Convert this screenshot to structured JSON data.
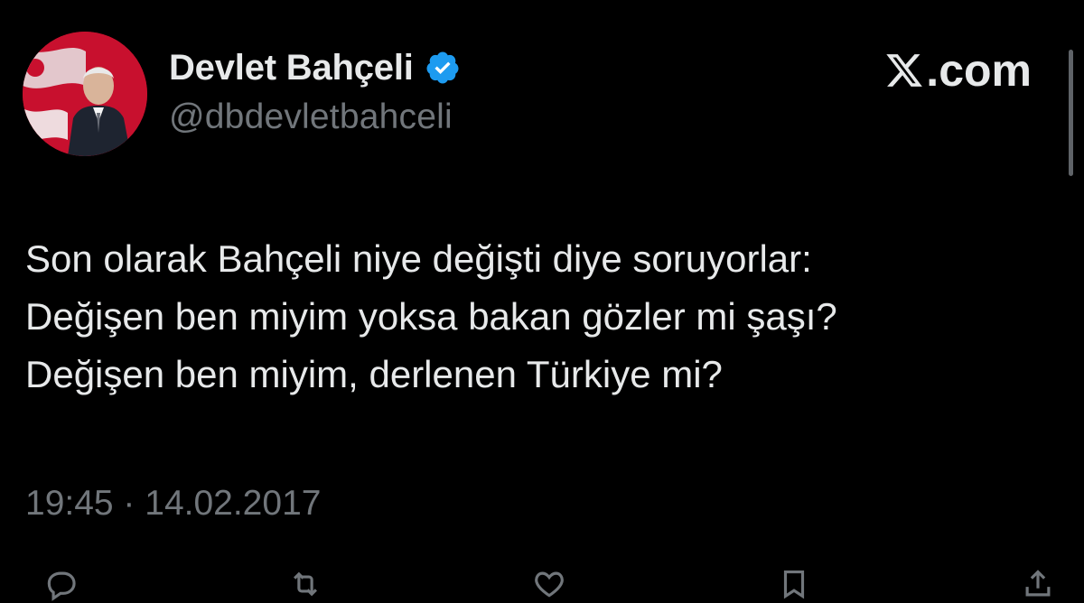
{
  "author": {
    "display_name": "Devlet Bahçeli",
    "handle": "@dbdevletbahceli",
    "verified": true,
    "verified_color": "#1d9bf0",
    "avatar_icon": "profile-photo"
  },
  "brand": {
    "label": ".com",
    "logo_icon": "x-logo-icon"
  },
  "tweet": {
    "lines": [
      "Son olarak Bahçeli niye değişti diye soruyorlar:",
      "Değişen ben miyim yoksa bakan gözler mi şaşı?",
      "Değişen ben miyim, derlenen Türkiye mi?"
    ],
    "timestamp": "19:45 · 14.02.2017"
  },
  "actions": {
    "reply_icon": "reply-icon",
    "repost_icon": "repost-icon",
    "like_icon": "like-icon",
    "bookmark_icon": "bookmark-icon",
    "share_icon": "share-icon"
  },
  "colors": {
    "background": "#000000",
    "text": "#e7e9ea",
    "secondary": "#71767b"
  }
}
